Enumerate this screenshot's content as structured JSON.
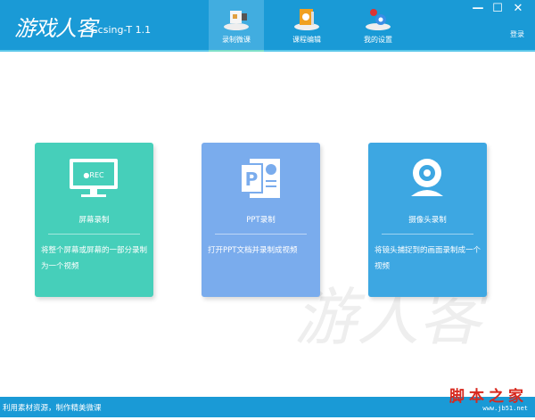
{
  "app": {
    "logo": "游戏人客",
    "version": "Ccsing-T 1.1",
    "login": "登录"
  },
  "nav": [
    {
      "label": "录制微课"
    },
    {
      "label": "课程编辑"
    },
    {
      "label": "我的设置"
    }
  ],
  "window": {
    "minimize": "—",
    "maximize": "☐",
    "close": "✕"
  },
  "cards": [
    {
      "title": "屏幕录制",
      "desc": "将整个屏幕或屏幕的一部分录制为一个视频",
      "badge": "●REC",
      "color": "#46cfba"
    },
    {
      "title": "PPT录制",
      "desc": "打开PPT文档并录制成视频",
      "badge": "P",
      "color": "#7aaced"
    },
    {
      "title": "摄像头录制",
      "desc": "将镜头捕捉到的画面录制成一个视频",
      "color": "#3da7e2"
    }
  ],
  "status": {
    "text": "利用素材资源，制作精美微课"
  },
  "watermark": {
    "cn": "脚本之家",
    "url": "www.jb51.net"
  }
}
